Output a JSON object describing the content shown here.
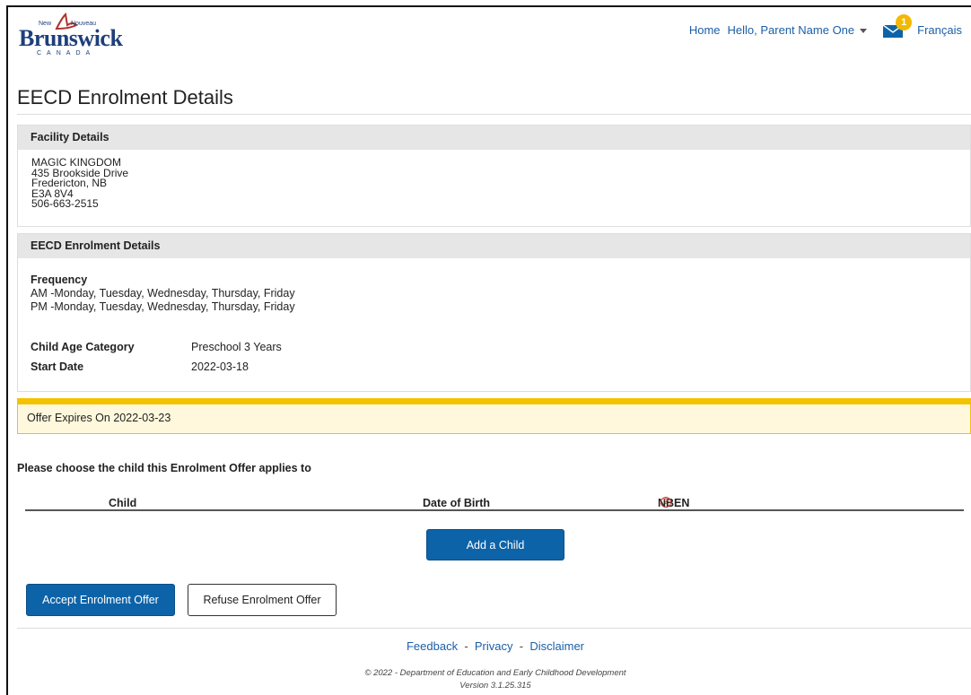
{
  "header": {
    "logo": {
      "new": "New",
      "nouveau": "Nouveau",
      "brand": "Brunswick",
      "country": "CANADA"
    },
    "nav": {
      "home": "Home",
      "user": "Hello, Parent Name One",
      "messages_count": "1",
      "language": "Français"
    }
  },
  "page_title": "EECD Enrolment Details",
  "facility": {
    "heading": "Facility Details",
    "name": "MAGIC KINGDOM",
    "street": "435 Brookside Drive",
    "city": "Fredericton, NB",
    "postal": "E3A 8V4",
    "phone": "506-663-2515"
  },
  "enrolment": {
    "heading": "EECD Enrolment Details",
    "frequency_label": "Frequency",
    "frequency_am": "AM -Monday, Tuesday, Wednesday, Thursday, Friday",
    "frequency_pm": "PM -Monday, Tuesday, Wednesday, Thursday, Friday",
    "age_category_label": "Child Age Category",
    "age_category_value": "Preschool 3 Years",
    "start_date_label": "Start Date",
    "start_date_value": "2022-03-18"
  },
  "alert": {
    "text": "Offer Expires On 2022-03-23"
  },
  "child_table": {
    "prompt": "Please choose the child this Enrolment Offer applies to",
    "columns": [
      "Child",
      "Date of Birth",
      "NBEN"
    ],
    "help_glyph": "?",
    "add_child_label": "Add a Child"
  },
  "actions": {
    "accept_label": "Accept Enrolment Offer",
    "refuse_label": "Refuse Enrolment Offer"
  },
  "footer": {
    "links": [
      "Feedback",
      "Privacy",
      "Disclaimer"
    ],
    "separator": "-",
    "copyright": "© 2022 - Department of Education and Early Childhood Development",
    "version": "Version 3.1.25.315"
  },
  "colors": {
    "primary": "#0d63a8",
    "link": "#1b5fa8",
    "alert_border": "#f3c200",
    "alert_bg": "#fff8dc",
    "badge": "#f3b800"
  }
}
